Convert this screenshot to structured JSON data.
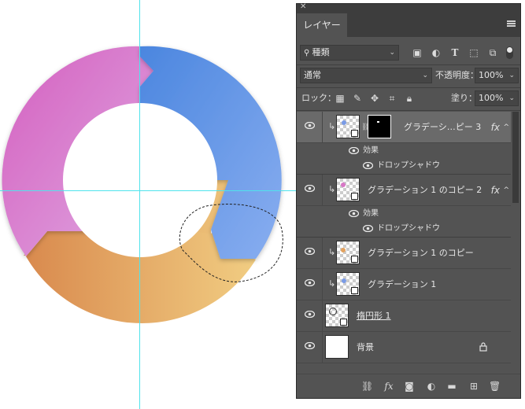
{
  "canvas": {
    "ring_colors": {
      "pink": "#d977c6",
      "blue": "#5a8fe0",
      "orange": "#e3a25e",
      "yellow": "#f0cc82"
    },
    "guide_color": "#4fe3ec"
  },
  "panel": {
    "close_glyph": "✕",
    "tab_label": "レイヤー",
    "filter": {
      "value": "種類"
    },
    "blend_mode": {
      "value": "通常"
    },
    "opacity": {
      "label": "不透明度：",
      "value": "100%"
    },
    "lock": {
      "label": "ロック："
    },
    "fill": {
      "label": "塗り：",
      "value": "100%"
    },
    "layers": [
      {
        "name": "グラデーシ…ピー 3",
        "fx": "fx",
        "selected": true
      },
      {
        "name": "グラデーション 1 のコピー 2",
        "fx": "fx"
      },
      {
        "name": "グラデーション 1 のコピー"
      },
      {
        "name": "グラデーション 1"
      },
      {
        "name": "楕円形 1"
      },
      {
        "name": "背景"
      }
    ],
    "effects": [
      {
        "label": "効果"
      },
      {
        "label": "ドロップシャドウ"
      },
      {
        "label": "効果"
      },
      {
        "label": "ドロップシャドウ"
      }
    ],
    "bottom_icons": [
      "link-icon",
      "fx-icon",
      "mask-icon",
      "adjustment-icon",
      "folder-icon",
      "new-layer-icon",
      "trash-icon"
    ],
    "bottom_fx": "fx"
  }
}
